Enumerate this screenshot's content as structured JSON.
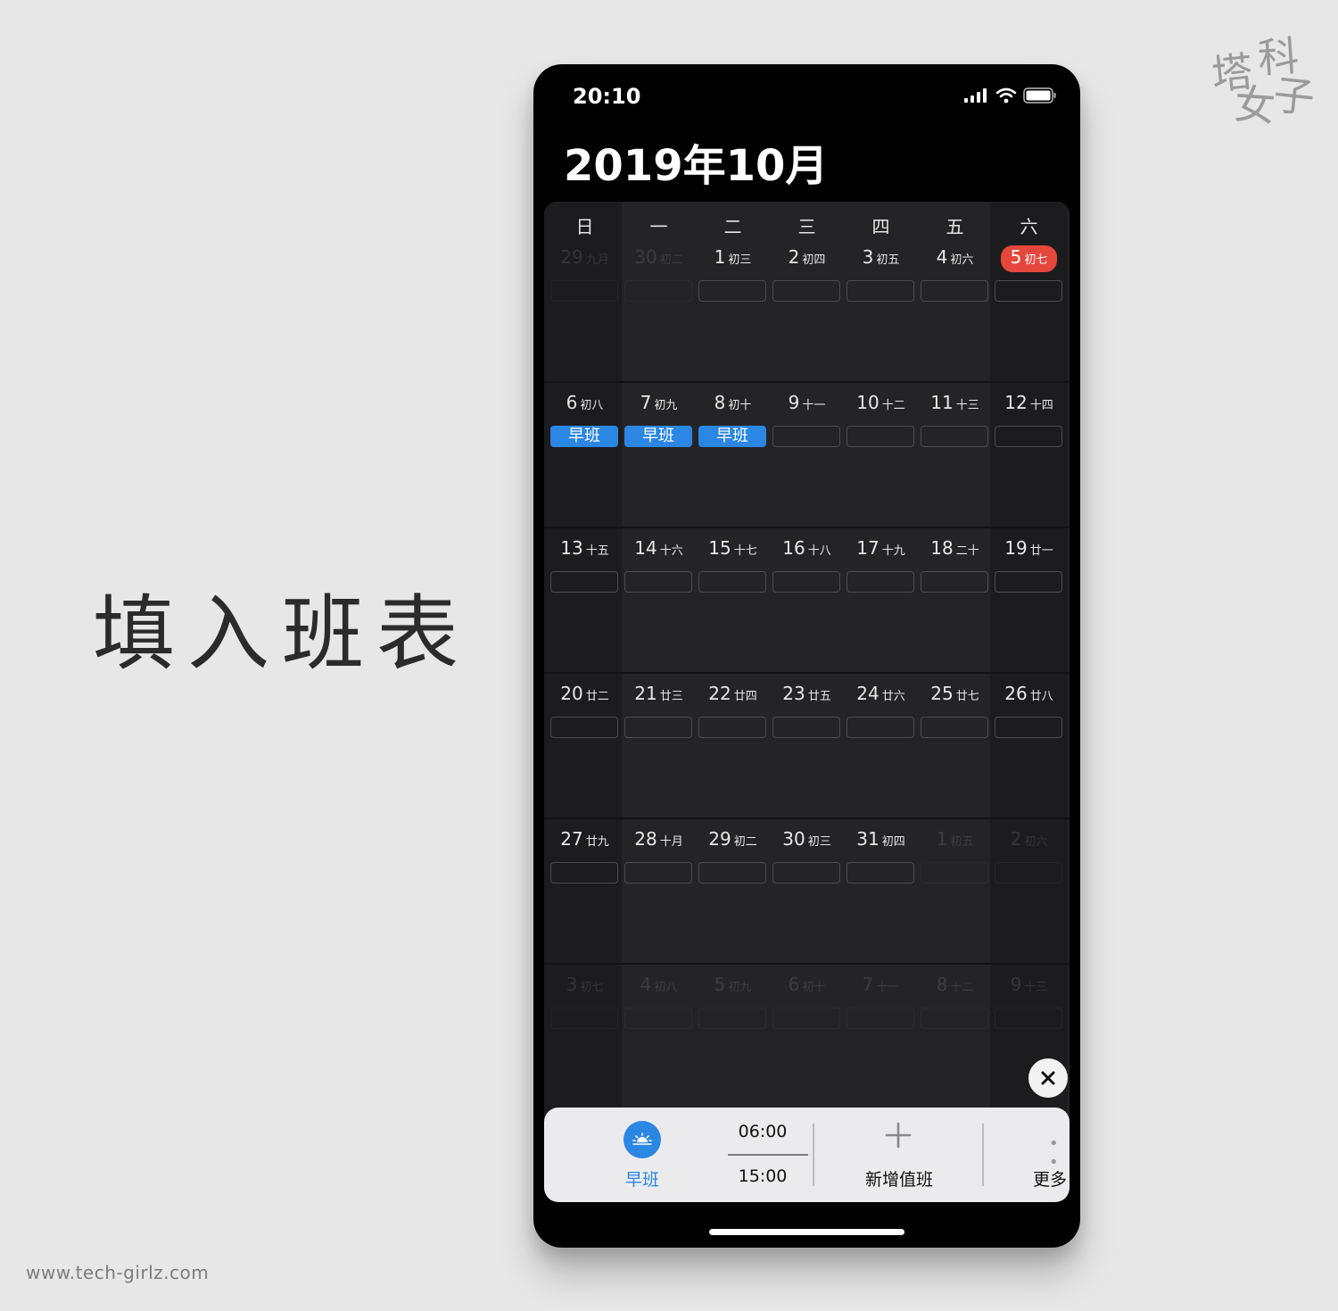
{
  "page": {
    "heading": "填入班表",
    "watermark_url": "www.tech-girlz.com",
    "logo_chars": [
      "塔",
      "科",
      "女",
      "子"
    ]
  },
  "phone": {
    "status_time": "20:10",
    "month_title": "2019年10月",
    "weekdays": [
      "日",
      "一",
      "二",
      "三",
      "四",
      "五",
      "六"
    ],
    "weeks": [
      [
        {
          "day": "29",
          "lunar": "九月",
          "in_month": false
        },
        {
          "day": "30",
          "lunar": "初二",
          "in_month": false
        },
        {
          "day": "1",
          "lunar": "初三",
          "in_month": true
        },
        {
          "day": "2",
          "lunar": "初四",
          "in_month": true
        },
        {
          "day": "3",
          "lunar": "初五",
          "in_month": true
        },
        {
          "day": "4",
          "lunar": "初六",
          "in_month": true
        },
        {
          "day": "5",
          "lunar": "初七",
          "in_month": true,
          "today": true
        }
      ],
      [
        {
          "day": "6",
          "lunar": "初八",
          "in_month": true,
          "shift": "早班"
        },
        {
          "day": "7",
          "lunar": "初九",
          "in_month": true,
          "shift": "早班"
        },
        {
          "day": "8",
          "lunar": "初十",
          "in_month": true,
          "shift": "早班"
        },
        {
          "day": "9",
          "lunar": "十一",
          "in_month": true
        },
        {
          "day": "10",
          "lunar": "十二",
          "in_month": true
        },
        {
          "day": "11",
          "lunar": "十三",
          "in_month": true
        },
        {
          "day": "12",
          "lunar": "十四",
          "in_month": true
        }
      ],
      [
        {
          "day": "13",
          "lunar": "十五",
          "in_month": true
        },
        {
          "day": "14",
          "lunar": "十六",
          "in_month": true
        },
        {
          "day": "15",
          "lunar": "十七",
          "in_month": true
        },
        {
          "day": "16",
          "lunar": "十八",
          "in_month": true
        },
        {
          "day": "17",
          "lunar": "十九",
          "in_month": true
        },
        {
          "day": "18",
          "lunar": "二十",
          "in_month": true
        },
        {
          "day": "19",
          "lunar": "廿一",
          "in_month": true
        }
      ],
      [
        {
          "day": "20",
          "lunar": "廿二",
          "in_month": true
        },
        {
          "day": "21",
          "lunar": "廿三",
          "in_month": true
        },
        {
          "day": "22",
          "lunar": "廿四",
          "in_month": true
        },
        {
          "day": "23",
          "lunar": "廿五",
          "in_month": true
        },
        {
          "day": "24",
          "lunar": "廿六",
          "in_month": true
        },
        {
          "day": "25",
          "lunar": "廿七",
          "in_month": true
        },
        {
          "day": "26",
          "lunar": "廿八",
          "in_month": true
        }
      ],
      [
        {
          "day": "27",
          "lunar": "廿九",
          "in_month": true
        },
        {
          "day": "28",
          "lunar": "十月",
          "in_month": true
        },
        {
          "day": "29",
          "lunar": "初二",
          "in_month": true
        },
        {
          "day": "30",
          "lunar": "初三",
          "in_month": true
        },
        {
          "day": "31",
          "lunar": "初四",
          "in_month": true
        },
        {
          "day": "1",
          "lunar": "初五",
          "in_month": false
        },
        {
          "day": "2",
          "lunar": "初六",
          "in_month": false
        }
      ],
      [
        {
          "day": "3",
          "lunar": "初七",
          "in_month": false
        },
        {
          "day": "4",
          "lunar": "初八",
          "in_month": false
        },
        {
          "day": "5",
          "lunar": "初九",
          "in_month": false
        },
        {
          "day": "6",
          "lunar": "初十",
          "in_month": false
        },
        {
          "day": "7",
          "lunar": "十一",
          "in_month": false
        },
        {
          "day": "8",
          "lunar": "十二",
          "in_month": false
        },
        {
          "day": "9",
          "lunar": "十三",
          "in_month": false
        }
      ]
    ],
    "shift_bar": {
      "shift_name": "早班",
      "start_time": "06:00",
      "end_time": "15:00",
      "add_label": "新增值班",
      "more_label": "更多"
    },
    "colors": {
      "accent_blue": "#2b86e4",
      "today_red": "#e5473c"
    }
  }
}
